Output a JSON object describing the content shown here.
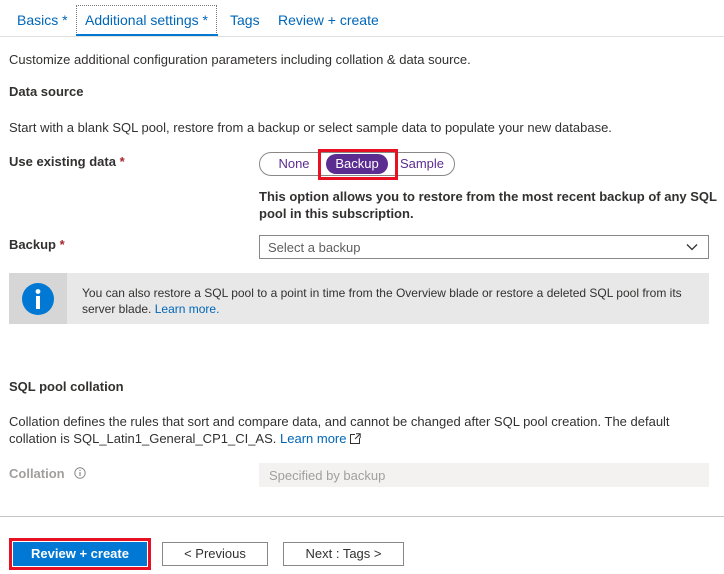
{
  "tabs": [
    {
      "label": "Basics",
      "required_mark": "*"
    },
    {
      "label": "Additional settings",
      "required_mark": "*"
    },
    {
      "label": "Tags",
      "required_mark": ""
    },
    {
      "label": "Review + create",
      "required_mark": ""
    }
  ],
  "intro": "Customize additional configuration parameters including collation & data source.",
  "data_source": {
    "heading": "Data source",
    "description": "Start with a blank SQL pool, restore from a backup or select sample data to populate your new database.",
    "use_existing_label": "Use existing data",
    "required_mark": "*",
    "options": [
      "None",
      "Backup",
      "Sample"
    ],
    "selected_option": "Backup",
    "option_help_line1": "This option allows you to restore from the most recent backup of any SQL",
    "option_help_line2": "pool in this subscription.",
    "backup_label": "Backup",
    "backup_placeholder": "Select a backup"
  },
  "info": {
    "text": "You can also restore a SQL pool to a point in time from the Overview blade or restore a deleted SQL pool from its server blade.",
    "link": "Learn more."
  },
  "collation_section": {
    "heading": "SQL pool collation",
    "description_line1": "Collation defines the rules that sort and compare data, and cannot be changed after SQL pool creation. The default",
    "description_line2": "collation is SQL_Latin1_General_CP1_CI_AS.",
    "learn_more": "Learn more",
    "collation_label": "Collation",
    "collation_value": "Specified by backup"
  },
  "footer": {
    "review_create": "Review + create",
    "previous": "< Previous",
    "next": "Next : Tags >"
  },
  "colors": {
    "accent": "#0078d4",
    "toggle_selected": "#5c2d91",
    "highlight_box": "#e81123",
    "info_icon": "#0078d4"
  },
  "icons": [
    "info-icon",
    "chevron-down-icon",
    "external-link-icon",
    "info-circle-icon"
  ]
}
